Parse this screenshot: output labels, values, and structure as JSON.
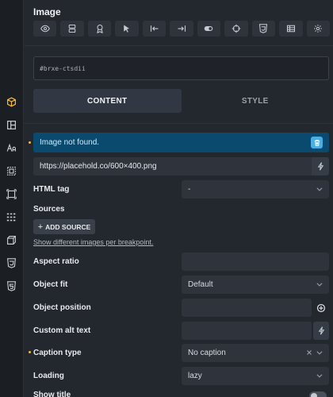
{
  "panel": {
    "title": "Image"
  },
  "toolbar": {
    "buttons": [
      "eye-icon",
      "layers-icon",
      "badge-icon",
      "cursor-icon",
      "align-left-icon",
      "align-right-icon",
      "toggle-icon",
      "crosshair-icon",
      "css-icon",
      "table-icon",
      "gear-icon"
    ]
  },
  "sidebar": {
    "icons": [
      "box-icon",
      "layout-icon",
      "typography-icon",
      "border-icon",
      "resize-icon",
      "grid-icon",
      "cube-icon",
      "css3-icon",
      "html5-icon"
    ]
  },
  "element": {
    "id_placeholder": "#brxe-ctsdii"
  },
  "tabs": [
    {
      "label": "CONTENT",
      "active": true
    },
    {
      "label": "STYLE",
      "active": false
    }
  ],
  "notice": {
    "text": "Image not found."
  },
  "image": {
    "url": "https://placehold.co/600×400.png"
  },
  "fields": {
    "html_tag": {
      "label": "HTML tag",
      "value": "-"
    },
    "sources": {
      "label": "Sources",
      "add_button": "ADD SOURCE",
      "link": "Show different images per breakpoint."
    },
    "aspect_ratio": {
      "label": "Aspect ratio",
      "value": ""
    },
    "object_fit": {
      "label": "Object fit",
      "value": "Default"
    },
    "object_position": {
      "label": "Object position",
      "value": ""
    },
    "custom_alt": {
      "label": "Custom alt text",
      "value": ""
    },
    "caption_type": {
      "label": "Caption type",
      "value": "No caption"
    },
    "loading": {
      "label": "Loading",
      "value": "lazy"
    },
    "show_title": {
      "label": "Show title"
    }
  },
  "colors": {
    "accent": "#f5b83d",
    "notice_bg": "#0b4a6f",
    "notice_button": "#4aaee3",
    "panel_bg": "#23272e"
  }
}
